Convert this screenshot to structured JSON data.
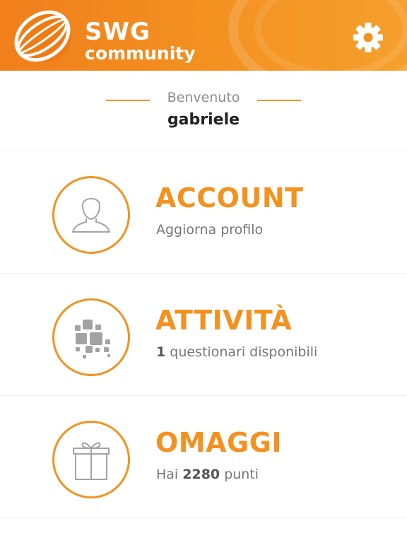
{
  "header": {
    "brand_line1": "SWG",
    "brand_line2": "community",
    "settings_icon": "gear-icon",
    "colors": {
      "bg": "#f39221",
      "text": "#ffffff"
    }
  },
  "welcome": {
    "greeting": "Benvenuto",
    "username": "gabriele"
  },
  "menu": {
    "account": {
      "title": "ACCOUNT",
      "subtitle": "Aggiorna profilo",
      "icon": "user-icon"
    },
    "activity": {
      "title": "ATTIVITÀ",
      "count": "1",
      "subtitle": "questionari disponibili",
      "icon": "mosaic-icon"
    },
    "gifts": {
      "title": "OMAGGI",
      "prefix": "Hai",
      "points": "2280",
      "suffix": "punti",
      "icon": "gift-icon"
    }
  },
  "accent_color": "#f39221"
}
